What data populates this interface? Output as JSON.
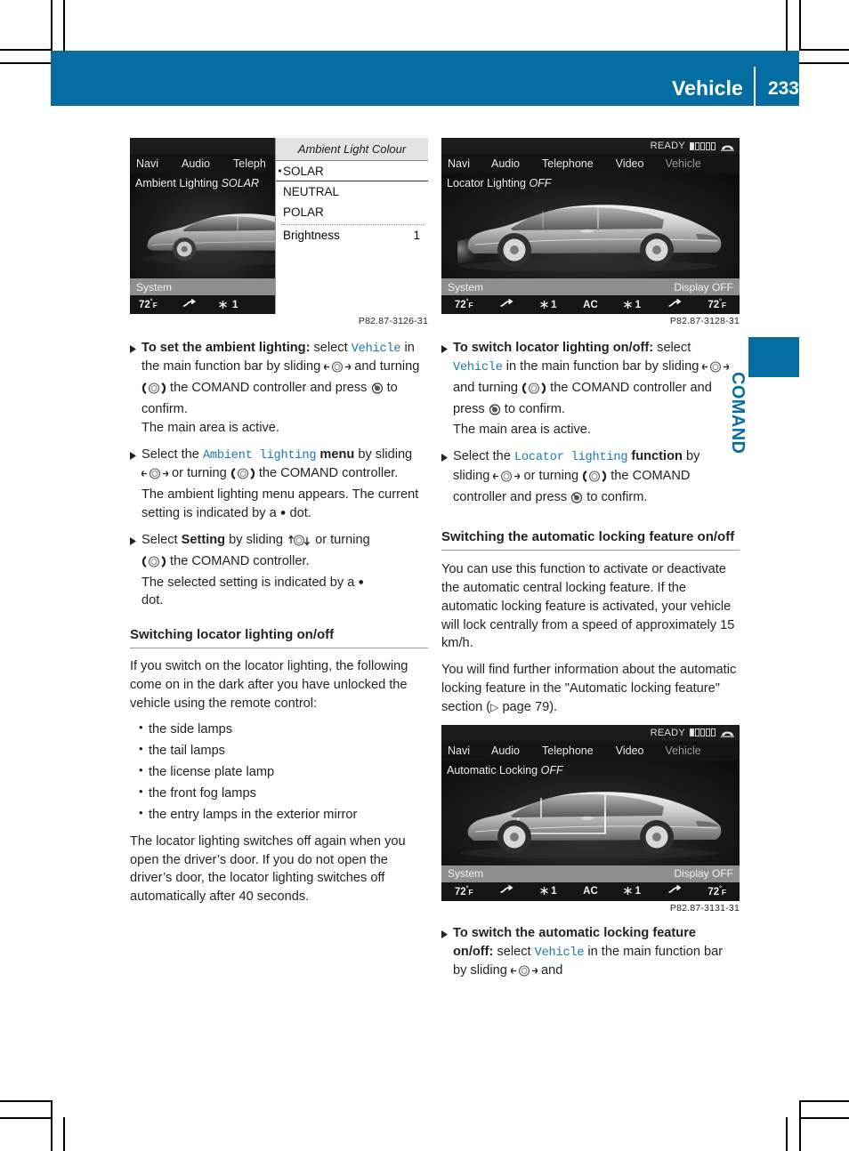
{
  "header": {
    "title": "Vehicle",
    "page_number": "233",
    "accent_color": "#046da2"
  },
  "thumb_tab": {
    "label": "COMAND"
  },
  "figures": {
    "fig1": {
      "caption": "P82.87-3126-31",
      "left_panel": {
        "menubar": [
          "Navi",
          "Audio",
          "Teleph"
        ],
        "main_label_text": "Ambient Lighting ",
        "main_label_value": "SOLAR",
        "system_label": "System",
        "climate": [
          "72",
          "F"
        ]
      },
      "right_panel": {
        "title": "Ambient Light Colour",
        "options": [
          "SOLAR",
          "NEUTRAL",
          "POLAR"
        ],
        "selected_option": "SOLAR",
        "brightness_label": "Brightness",
        "brightness_value": "1"
      }
    },
    "fig2": {
      "caption": "P82.87-3128-31",
      "status_text": "READY",
      "menubar": [
        "Navi",
        "Audio",
        "Telephone",
        "Video",
        "Vehicle"
      ],
      "active_menu_item": "Vehicle",
      "main_label_text": "Locator Lighting ",
      "main_label_value": "OFF",
      "system_label": "System",
      "display_off_label": "Display OFF",
      "climate_left_temp": "72",
      "climate_right_temp": "72",
      "climate_unit": "F",
      "climate_fan_left": "1",
      "climate_fan_right": "1",
      "climate_ac": "AC"
    },
    "fig3": {
      "caption": "P82.87-3131-31",
      "status_text": "READY",
      "menubar": [
        "Navi",
        "Audio",
        "Telephone",
        "Video",
        "Vehicle"
      ],
      "active_menu_item": "Vehicle",
      "main_label_text": "Automatic Locking ",
      "main_label_value": "OFF",
      "system_label": "System",
      "display_off_label": "Display OFF",
      "climate_left_temp": "72",
      "climate_right_temp": "72",
      "climate_unit": "F",
      "climate_fan_left": "1",
      "climate_fan_right": "1",
      "climate_ac": "AC"
    }
  },
  "left_column": {
    "step1": {
      "lead": "To set the ambient lighting:",
      "t1": " select ",
      "code": "Vehicle",
      "t2": " in the main function bar by sliding ",
      "t3": " and turning ",
      "t4": " the COMAND controller and press ",
      "t5": " to confirm.",
      "result": "The main area is active."
    },
    "step2": {
      "t1": "Select the ",
      "code": "Ambient lighting",
      "bold": " menu",
      "t2": " by sliding ",
      "t3": " or turning ",
      "t4": " the COMAND controller.",
      "result": "The ambient lighting menu appears. The current setting is indicated by a",
      "result2": "dot."
    },
    "step3": {
      "t1": "Select ",
      "bold": "Setting",
      "t2": " by sliding ",
      "t3": " or turning ",
      "t4": " the COMAND controller.",
      "result": "The selected setting is indicated by a",
      "result2": "dot."
    },
    "section_title": "Switching locator lighting on/off",
    "para1": "If you switch on the locator lighting, the following come on in the dark after you have unlocked the vehicle using the remote control:",
    "bullets": [
      "the side lamps",
      "the tail lamps",
      "the license plate lamp",
      "the front fog lamps",
      "the entry lamps in the exterior mirror"
    ],
    "para2": "The locator lighting switches off again when you open the driver’s door. If you do not open the driver’s door, the locator lighting switches off automatically after 40 seconds."
  },
  "right_column": {
    "step1": {
      "lead": "To switch locator lighting on/off:",
      "t1": " select ",
      "code": "Vehicle",
      "t2": " in the main function bar by sliding ",
      "t3": " and turning ",
      "t4": " the COMAND controller and press ",
      "t5": " to confirm.",
      "result": "The main area is active."
    },
    "step2": {
      "t1": "Select the ",
      "code": "Locator lighting",
      "bold": " function",
      "t2": " by sliding ",
      "t3": " or turning ",
      "t4": " the COMAND controller and press ",
      "t5": " to confirm."
    },
    "section_title": "Switching the automatic locking feature on/off",
    "para1": "You can use this function to activate or deactivate the automatic central locking feature. If the automatic locking feature is activated, your vehicle will lock centrally from a speed of approximately 15 km/h.",
    "para2_a": "You will find further information about the automatic locking feature in the \"Automatic locking feature\" section (",
    "para2_ref": " page 79).",
    "step3": {
      "lead": "To switch the automatic locking feature on/off:",
      "t1": " select ",
      "code": "Vehicle",
      "t2": " in the main function bar by sliding ",
      "t3": " and"
    }
  }
}
